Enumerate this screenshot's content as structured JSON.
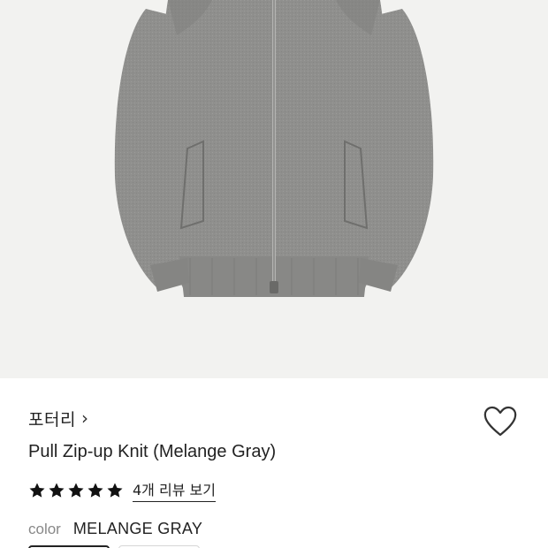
{
  "product": {
    "image_alt": "gray zip-up knit jacket",
    "brand": "포터리",
    "brand_chevron": "›",
    "title": "Pull Zip-up Knit (Melange Gray)",
    "rating": 5,
    "rating_max": 5,
    "review_link": "4개 리뷰 보기",
    "color_label": "color",
    "color_value": "MELANGE GRAY"
  },
  "icons": {
    "wishlist": "heart-outline-icon",
    "star": "star-filled-icon",
    "chevron": "chevron-right-icon"
  },
  "colors": {
    "hero_bg": "#f2f2f0",
    "knit_gray": "#8e8e8c",
    "text_primary": "#222222",
    "text_secondary": "#888888"
  }
}
